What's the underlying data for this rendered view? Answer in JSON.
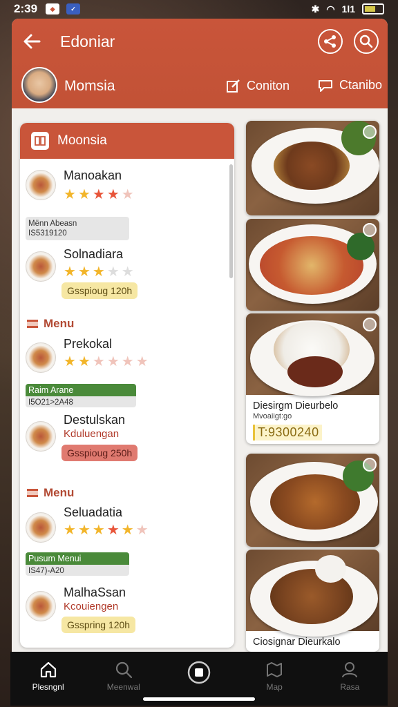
{
  "status_bar": {
    "time": "2:39",
    "signal": "1l1"
  },
  "header": {
    "title": "Edoniar",
    "profile_name": "Momsia",
    "action_1": "Coniton",
    "action_2": "Ctanibo"
  },
  "list": {
    "header_title": "Moonsia",
    "items": [
      {
        "name": "Manoakan",
        "rating": [
          1,
          1,
          2,
          2,
          3
        ]
      },
      {
        "tag_line1": "Mënn Abeasn",
        "tag_line2": "IS5319120"
      },
      {
        "name": "Solnadiara",
        "rating": [
          0,
          1,
          1,
          0,
          0
        ],
        "price": "Gsspioug 120h"
      },
      {
        "section": "Menu"
      },
      {
        "name": "Prekokal",
        "rating": [
          1,
          1,
          3,
          3,
          3,
          3
        ]
      },
      {
        "tag_line1": "Raim Arane",
        "tag_line2": "I5O21>2A48"
      },
      {
        "name": "Destulskan",
        "sub": "Kduluengan",
        "price": "Gsspioug 250h"
      },
      {
        "section": "Menu"
      },
      {
        "name": "Seluadatia",
        "rating": [
          1,
          1,
          2,
          2,
          1,
          3
        ]
      },
      {
        "tag_line1": "Pusum Menui",
        "tag_line2": "IS47)-A20"
      },
      {
        "name": "MalhaSsan",
        "sub": "Kcouiengen",
        "price": "Gsspring 120h"
      }
    ]
  },
  "photos": [
    {
      "caption": "",
      "sub": "",
      "price": ""
    },
    {
      "caption": "",
      "sub": "",
      "price": ""
    },
    {
      "caption": "Diesirgm Dieurbelo",
      "sub": "Mvoaiigt:go",
      "price": "T:9300240"
    },
    {
      "caption": "",
      "sub": "",
      "price": ""
    },
    {
      "caption": "Ciosignar Dieurkalo",
      "sub": "",
      "price": ""
    }
  ],
  "nav": [
    {
      "label": "Plesngnl",
      "icon": "home-icon",
      "active": true
    },
    {
      "label": "Meenwal",
      "icon": "search-icon",
      "active": false
    },
    {
      "label": "",
      "icon": "record-icon",
      "active": false
    },
    {
      "label": "Map",
      "icon": "map-icon",
      "active": false
    },
    {
      "label": "Rasa",
      "icon": "profile-icon",
      "active": false
    }
  ],
  "colors": {
    "accent": "#c9553a",
    "star": "#f2b52a",
    "price_bg": "#f6e7a3"
  }
}
